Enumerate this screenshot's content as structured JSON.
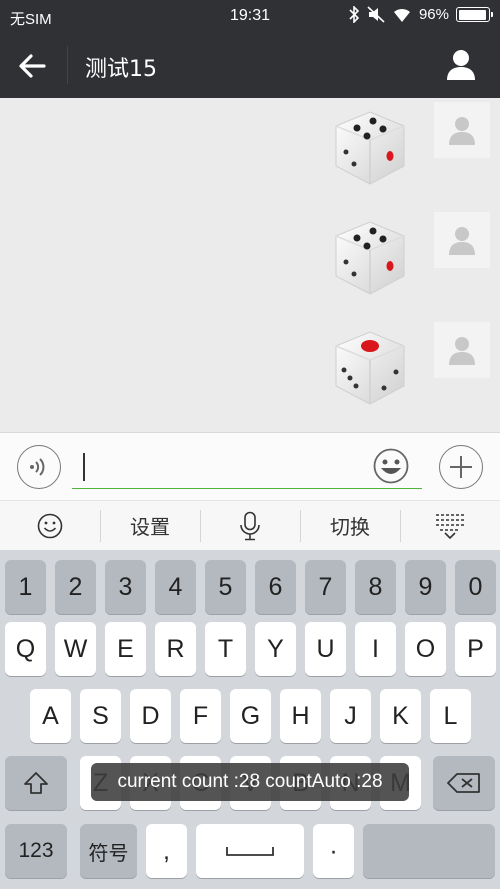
{
  "status_bar": {
    "carrier": "无SIM",
    "time": "19:31",
    "battery": "96%",
    "battery_level": 0.96
  },
  "nav": {
    "title": "测试15"
  },
  "messages": [
    {
      "dice_face": 4
    },
    {
      "dice_face": 4
    },
    {
      "dice_face": 1
    }
  ],
  "input": {
    "value": ""
  },
  "toolbar": {
    "items": [
      "emoji-icon",
      "设置",
      "microphone-icon",
      "切换",
      "keyboard-hide-icon"
    ],
    "settings_label": "设置",
    "switch_label": "切换"
  },
  "keyboard": {
    "row_numbers": [
      "1",
      "2",
      "3",
      "4",
      "5",
      "6",
      "7",
      "8",
      "9",
      "0"
    ],
    "row_top": [
      "Q",
      "W",
      "E",
      "R",
      "T",
      "Y",
      "U",
      "I",
      "O",
      "P"
    ],
    "row_middle": [
      "A",
      "S",
      "D",
      "F",
      "G",
      "H",
      "J",
      "K",
      "L"
    ],
    "row_bottom": [
      "Z",
      "X",
      "C",
      "V",
      "B",
      "N",
      "M"
    ],
    "key_123": "123",
    "key_symbols": "符号",
    "key_comma": ",",
    "key_period": "·"
  },
  "toast": {
    "text": "current count :28 countAuto :28"
  },
  "colors": {
    "header_bg": "#2f3135",
    "input_underline": "#4fb53a",
    "chat_bg": "#ebebeb",
    "dice_pip_red": "#d9161c"
  }
}
